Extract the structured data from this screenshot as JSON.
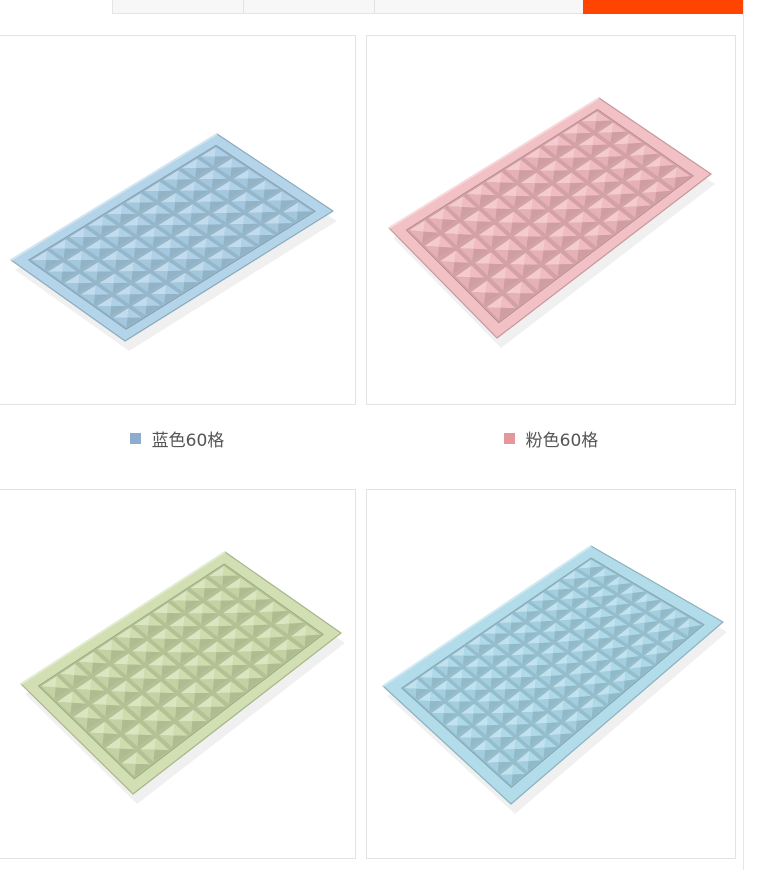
{
  "tabs": {
    "accent_color": "#ff4400"
  },
  "products": [
    {
      "caption": "蓝色60格",
      "swatch_color": "#8eabd0",
      "tray_color": "#aacfe6",
      "image": "blue-60-cell-ice-tray"
    },
    {
      "caption": "粉色60格",
      "swatch_color": "#e4989a",
      "tray_color": "#f0b8bd",
      "image": "pink-60-cell-ice-tray"
    },
    {
      "caption": "",
      "swatch_color": "",
      "tray_color": "#cbdba9",
      "image": "green-60-cell-ice-tray"
    },
    {
      "caption": "",
      "swatch_color": "",
      "tray_color": "#a9d7e8",
      "image": "blue-96-cell-ice-tray"
    }
  ]
}
